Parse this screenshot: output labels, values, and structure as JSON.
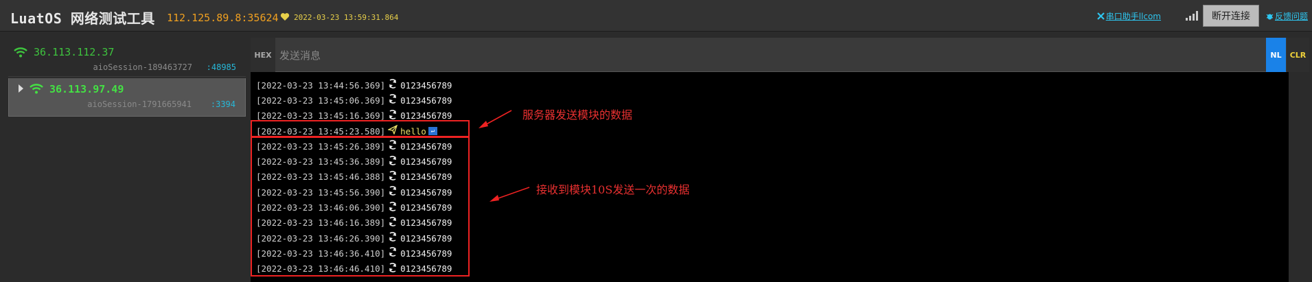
{
  "header": {
    "title": "LuatOS 网络测试工具",
    "server_address": "112.125.89.8:35624",
    "server_time": "2022-03-23 13:59:31.864",
    "serial_link": "串口助手llcom",
    "disconnect_label": "断开连接",
    "feedback_link": "反馈问题"
  },
  "sessions": [
    {
      "ip": "36.113.112.37",
      "session_id": "aioSession-189463727",
      "port": ":48985",
      "selected": false
    },
    {
      "ip": "36.113.97.49",
      "session_id": "aioSession-1791665941",
      "port": ":3394",
      "selected": true
    }
  ],
  "input_bar": {
    "hex_label": "HEX",
    "placeholder": "发送消息",
    "nl_label": "NL",
    "clr_label": "CLR"
  },
  "log": [
    {
      "time": "[2022-03-23 13:44:56.369]",
      "dir": "recv",
      "text": "0123456789"
    },
    {
      "time": "[2022-03-23 13:45:06.369]",
      "dir": "recv",
      "text": "0123456789"
    },
    {
      "time": "[2022-03-23 13:45:16.369]",
      "dir": "recv",
      "text": "0123456789"
    },
    {
      "time": "[2022-03-23 13:45:23.580]",
      "dir": "send",
      "text": "hello"
    },
    {
      "time": "[2022-03-23 13:45:26.389]",
      "dir": "recv",
      "text": "0123456789"
    },
    {
      "time": "[2022-03-23 13:45:36.389]",
      "dir": "recv",
      "text": "0123456789"
    },
    {
      "time": "[2022-03-23 13:45:46.388]",
      "dir": "recv",
      "text": "0123456789"
    },
    {
      "time": "[2022-03-23 13:45:56.390]",
      "dir": "recv",
      "text": "0123456789"
    },
    {
      "time": "[2022-03-23 13:46:06.390]",
      "dir": "recv",
      "text": "0123456789"
    },
    {
      "time": "[2022-03-23 13:46:16.389]",
      "dir": "recv",
      "text": "0123456789"
    },
    {
      "time": "[2022-03-23 13:46:26.390]",
      "dir": "recv",
      "text": "0123456789"
    },
    {
      "time": "[2022-03-23 13:46:36.410]",
      "dir": "recv",
      "text": "0123456789"
    },
    {
      "time": "[2022-03-23 13:46:46.410]",
      "dir": "recv",
      "text": "0123456789"
    }
  ],
  "annotations": {
    "server_send": "服务器发送模块的数据",
    "module_recv": "接收到模块10S发送一次的数据"
  },
  "colors": {
    "accent_orange": "#f0a020",
    "accent_cyan": "#2ec6f0",
    "online_green": "#3ec43e",
    "nl_blue": "#1a82e8",
    "annotation_red": "#e22222"
  }
}
